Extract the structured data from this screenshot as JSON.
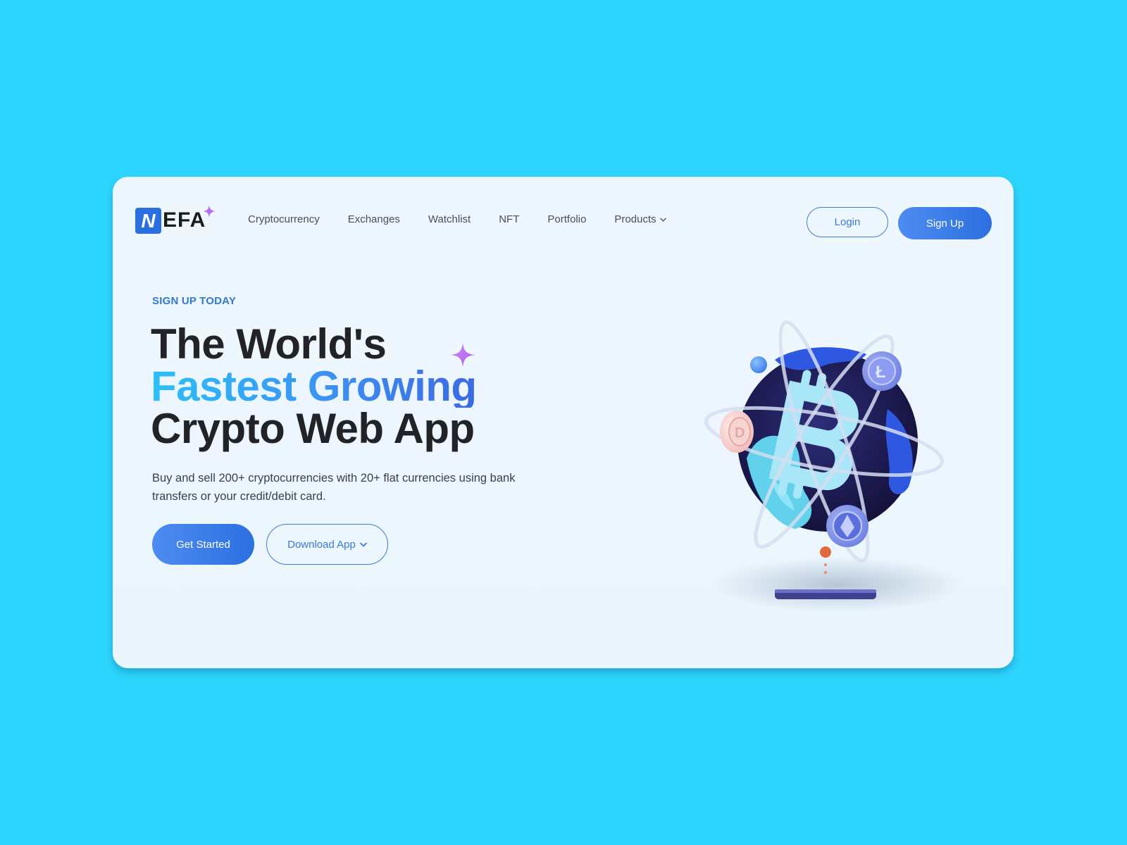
{
  "header": {
    "logo_letter": "N",
    "logo_text": "EFA",
    "nav": {
      "cryptocurrency": "Cryptocurrency",
      "exchanges": "Exchanges",
      "watchlist": "Watchlist",
      "nft": "NFT",
      "portfolio": "Portfolio",
      "products": "Products"
    },
    "login_label": "Login",
    "signup_label": "Sign Up"
  },
  "hero": {
    "eyebrow": "SIGN UP TODAY",
    "headline_line1": "The World's",
    "headline_line2": "Fastest Growing",
    "headline_line3": "Crypto Web App",
    "description": "Buy and sell 200+ cryptocurrencies with 20+ flat currencies using bank transfers or your credit/debit card.",
    "get_started_label": "Get Started",
    "download_label": "Download App"
  },
  "icons": [
    "sparkle-icon",
    "chevron-down-icon",
    "bitcoin-icon",
    "dogecoin-icon",
    "litecoin-icon",
    "ethereum-icon"
  ],
  "colors": {
    "page_background": "#2cd5fe",
    "card_background": "#eff7fe",
    "accent_blue": "#3377d6",
    "primary_button": "#2c6fe1",
    "heading_dark": "#222326",
    "sparkle_purple": "#b56cf0",
    "orange_ball": "#f39a4e"
  }
}
